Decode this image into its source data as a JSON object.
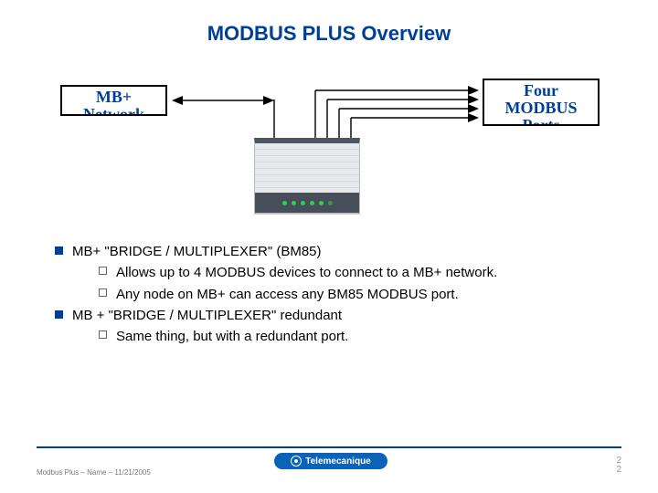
{
  "title": "MODBUS PLUS Overview",
  "labels": {
    "left": "MB+ Network",
    "right": "Four MODBUS Ports"
  },
  "bullets": [
    {
      "level": 1,
      "text": "MB+  \"BRIDGE / MULTIPLEXER\" (BM85)"
    },
    {
      "level": 2,
      "text": "Allows up to 4 MODBUS devices to connect to a MB+ network."
    },
    {
      "level": 2,
      "text": "Any node on MB+ can access any BM85 MODBUS port."
    },
    {
      "level": 1,
      "text": "MB +  \"BRIDGE / MULTIPLEXER\" redundant"
    },
    {
      "level": 2,
      "text": "Same thing, but with a redundant port."
    }
  ],
  "footer": {
    "left_prefix": "Modbus Plus  –  Name  – ",
    "date": "11/21/2005",
    "logo_text": "Telemecanique",
    "page_a": "2",
    "page_b": "2"
  }
}
